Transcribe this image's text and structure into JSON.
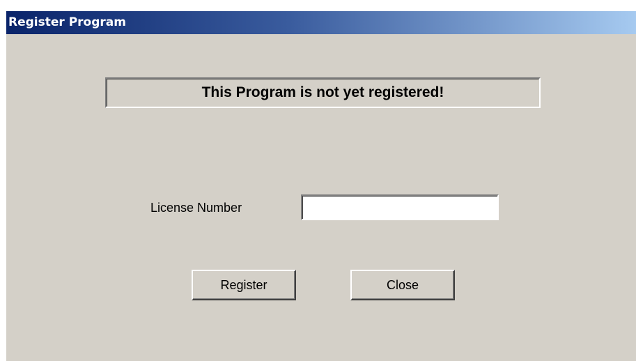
{
  "window": {
    "title": "Register Program"
  },
  "status": {
    "message": "This Program is not yet registered!"
  },
  "license": {
    "label": "License Number",
    "value": "",
    "placeholder": ""
  },
  "buttons": {
    "register_label": "Register",
    "close_label": "Close"
  },
  "colors": {
    "dialog_background": "#d4d0c8",
    "titlebar_start": "#0a246a",
    "titlebar_end": "#a6caf0",
    "title_text": "#ffffff"
  }
}
